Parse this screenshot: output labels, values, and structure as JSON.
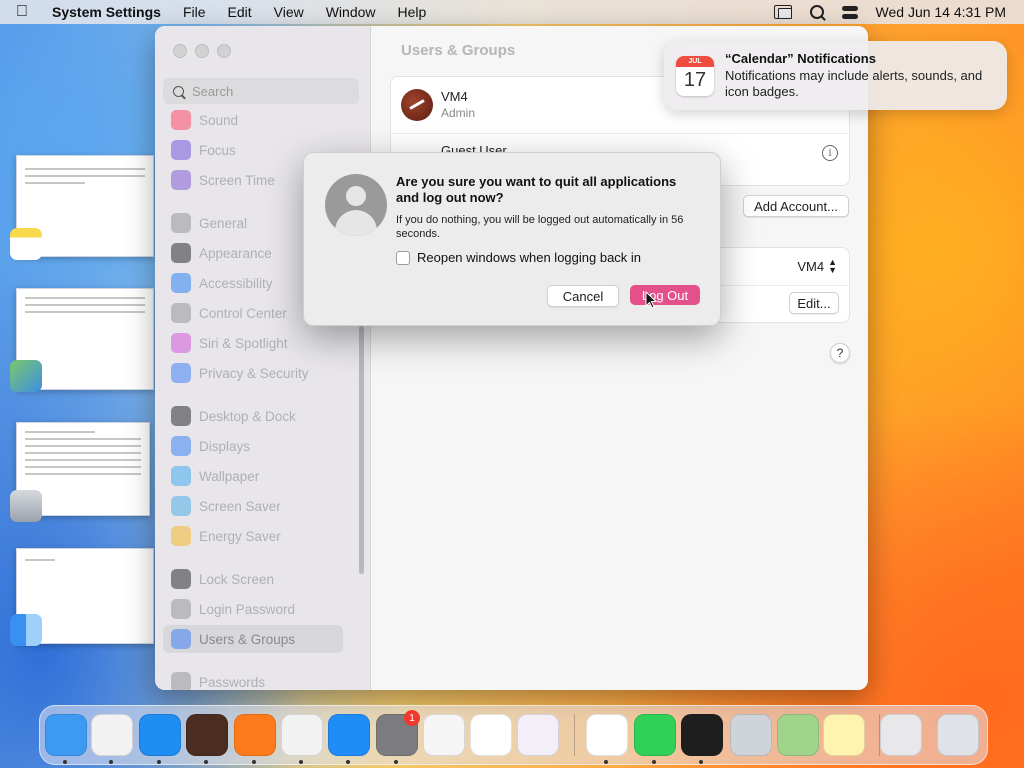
{
  "menubar": {
    "app": "System Settings",
    "items": [
      "File",
      "Edit",
      "View",
      "Window",
      "Help"
    ],
    "clock": "Wed Jun 14  4:31 PM"
  },
  "settings": {
    "title": "Users & Groups",
    "search_placeholder": "Search",
    "sidebar": [
      {
        "label": "Sound",
        "icon": "sound-icon",
        "color": "#ff3b5c"
      },
      {
        "label": "Focus",
        "icon": "focus-icon",
        "color": "#6a4cdb"
      },
      {
        "label": "Screen Time",
        "icon": "screen-time-icon",
        "color": "#7a52d6"
      },
      {
        "label": "General",
        "icon": "gear-icon",
        "color": "#8e8e93"
      },
      {
        "label": "Appearance",
        "icon": "appearance-icon",
        "color": "#1c1c1e"
      },
      {
        "label": "Accessibility",
        "icon": "accessibility-icon",
        "color": "#1a7cf2"
      },
      {
        "label": "Control Center",
        "icon": "control-center-icon",
        "color": "#8e8e93"
      },
      {
        "label": "Siri & Spotlight",
        "icon": "siri-icon",
        "color": "#d04bd8"
      },
      {
        "label": "Privacy & Security",
        "icon": "hand-icon",
        "color": "#3478f6"
      },
      {
        "label": "Desktop & Dock",
        "icon": "desktop-dock-icon",
        "color": "#1c1c1e"
      },
      {
        "label": "Displays",
        "icon": "displays-icon",
        "color": "#2f7cf6"
      },
      {
        "label": "Wallpaper",
        "icon": "wallpaper-icon",
        "color": "#35a6f0"
      },
      {
        "label": "Screen Saver",
        "icon": "screen-saver-icon",
        "color": "#3fa9e8"
      },
      {
        "label": "Energy Saver",
        "icon": "battery-icon",
        "color": "#f2b418"
      },
      {
        "label": "Lock Screen",
        "icon": "lock-icon",
        "color": "#1c1c1e"
      },
      {
        "label": "Login Password",
        "icon": "login-password-icon",
        "color": "#8e8e93"
      },
      {
        "label": "Users & Groups",
        "icon": "users-groups-icon",
        "color": "#3478f6"
      },
      {
        "label": "Passwords",
        "icon": "key-icon",
        "color": "#8e8e93"
      }
    ],
    "user": {
      "name": "VM4",
      "role": "Admin"
    },
    "guest_user": "Guest User",
    "add_account": "Add Account...",
    "auto_login_value": "VM4",
    "edit": "Edit...",
    "help": "?"
  },
  "dialog": {
    "title": "Are you sure you want to quit all applications and log out now?",
    "message": "If you do nothing, you will be logged out automatically in 56 seconds.",
    "checkbox_label": "Reopen windows when logging back in",
    "cancel": "Cancel",
    "confirm": "Log Out",
    "confirm_color": "#e3508a"
  },
  "notification": {
    "title": "“Calendar” Notifications",
    "body": "Notifications may include alerts, sounds, and icon badges.",
    "cal_month": "JUL",
    "cal_day": "17"
  },
  "dock": {
    "apps": [
      {
        "name": "finder-icon",
        "color": "#3d9af3"
      },
      {
        "name": "launchpad-icon",
        "color": "#f2f2f2"
      },
      {
        "name": "safari-icon",
        "color": "#1e8ef2"
      },
      {
        "name": "garageband-icon",
        "color": "#4a2c20"
      },
      {
        "name": "firefox-icon",
        "color": "#ff7a1a"
      },
      {
        "name": "chrome-icon",
        "color": "#f2f2f2"
      },
      {
        "name": "app-store-icon",
        "color": "#1f8cf7"
      },
      {
        "name": "system-settings-icon",
        "color": "#7b7b80"
      },
      {
        "name": "textedit-icon",
        "color": "#f5f5f5"
      },
      {
        "name": "vscode-icon",
        "color": "#ffffff"
      },
      {
        "name": "visual-studio-icon",
        "color": "#f3eef8"
      },
      {
        "name": "vscode-2-icon",
        "color": "#ffffff"
      },
      {
        "name": "facetime-icon",
        "color": "#2fd158"
      },
      {
        "name": "terminal-icon",
        "color": "#1e1e1e"
      },
      {
        "name": "installer-icon",
        "color": "#cfd3da"
      },
      {
        "name": "maps-icon",
        "color": "#9fd48a"
      },
      {
        "name": "notes-icon",
        "color": "#fff3b0"
      },
      {
        "name": "downloads-stack-icon",
        "color": "#e8e8ea"
      },
      {
        "name": "trash-icon",
        "color": "#dfe3e8"
      }
    ],
    "settings_badge": "1"
  }
}
